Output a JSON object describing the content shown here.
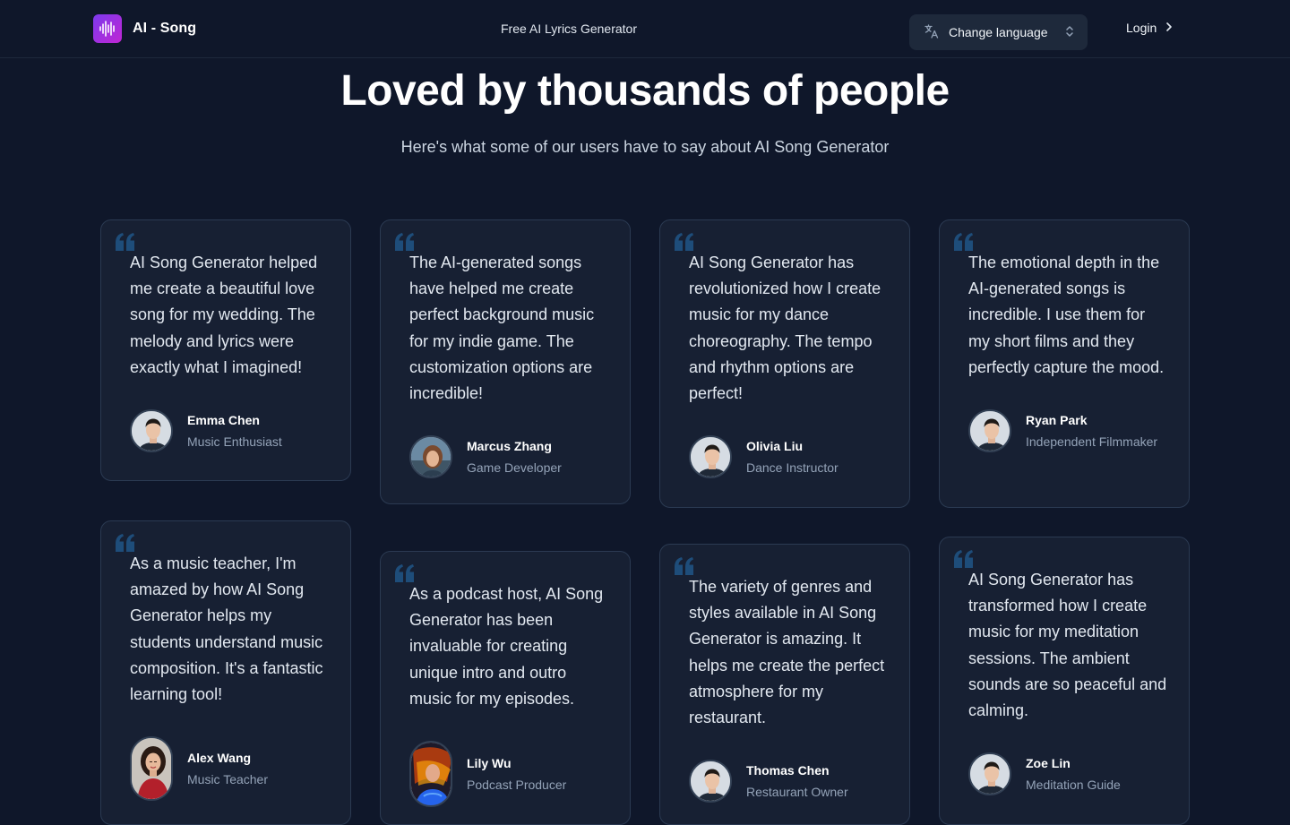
{
  "header": {
    "logo_text": "AI - Song",
    "nav_center": "Free AI Lyrics Generator",
    "language_button": "Change language",
    "login": "Login"
  },
  "hero": {
    "title": "Loved by thousands of people",
    "subtitle": "Here's what some of our users have to say about AI Song Generator"
  },
  "testimonials": [
    {
      "text": "AI Song Generator helped me create a beautiful love song for my wedding. The melody and lyrics were exactly what I imagined!",
      "name": "Emma Chen",
      "role": "Music Enthusiast",
      "avatar": "man-portrait"
    },
    {
      "text": "The AI-generated songs have helped me create perfect background music for my indie game. The customization options are incredible!",
      "name": "Marcus Zhang",
      "role": "Game Developer",
      "avatar": "woman-outdoor-portrait"
    },
    {
      "text": "AI Song Generator has revolutionized how I create music for my dance choreography. The tempo and rhythm options are perfect!",
      "name": "Olivia Liu",
      "role": "Dance Instructor",
      "avatar": "man-portrait"
    },
    {
      "text": "The emotional depth in the AI-generated songs is incredible. I use them for my short films and they perfectly capture the mood.",
      "name": "Ryan Park",
      "role": "Independent Filmmaker",
      "avatar": "man-portrait"
    },
    {
      "text": "As a music teacher, I'm amazed by how AI Song Generator helps my students understand music composition. It's a fantastic learning tool!",
      "name": "Alex Wang",
      "role": "Music Teacher",
      "avatar": "woman-red-dress-portrait"
    },
    {
      "text": "As a podcast host, AI Song Generator has been invaluable for creating unique intro and outro music for my episodes.",
      "name": "Lily Wu",
      "role": "Podcast Producer",
      "avatar": "woman-motion-portrait"
    },
    {
      "text": "The variety of genres and styles available in AI Song Generator is amazing. It helps me create the perfect atmosphere for my restaurant.",
      "name": "Thomas Chen",
      "role": "Restaurant Owner",
      "avatar": "man-portrait"
    },
    {
      "text": "AI Song Generator has transformed how I create music for my meditation sessions. The ambient sounds are so peaceful and calming.",
      "name": "Zoe Lin",
      "role": "Meditation Guide",
      "avatar": "man-portrait"
    }
  ],
  "colors": {
    "background": "#0f172a",
    "card": "#172033",
    "card_border": "#2b3a52",
    "quote_mark": "#1e4d7a",
    "logo_gradient_start": "#7c3aed",
    "logo_gradient_end": "#c026d3"
  },
  "icons": {
    "logo": "soundwave-icon",
    "language": "translate-icon",
    "language_chevron": "chevron-up-down-icon",
    "login": "chevron-right-icon",
    "quote": "quote-icon"
  }
}
